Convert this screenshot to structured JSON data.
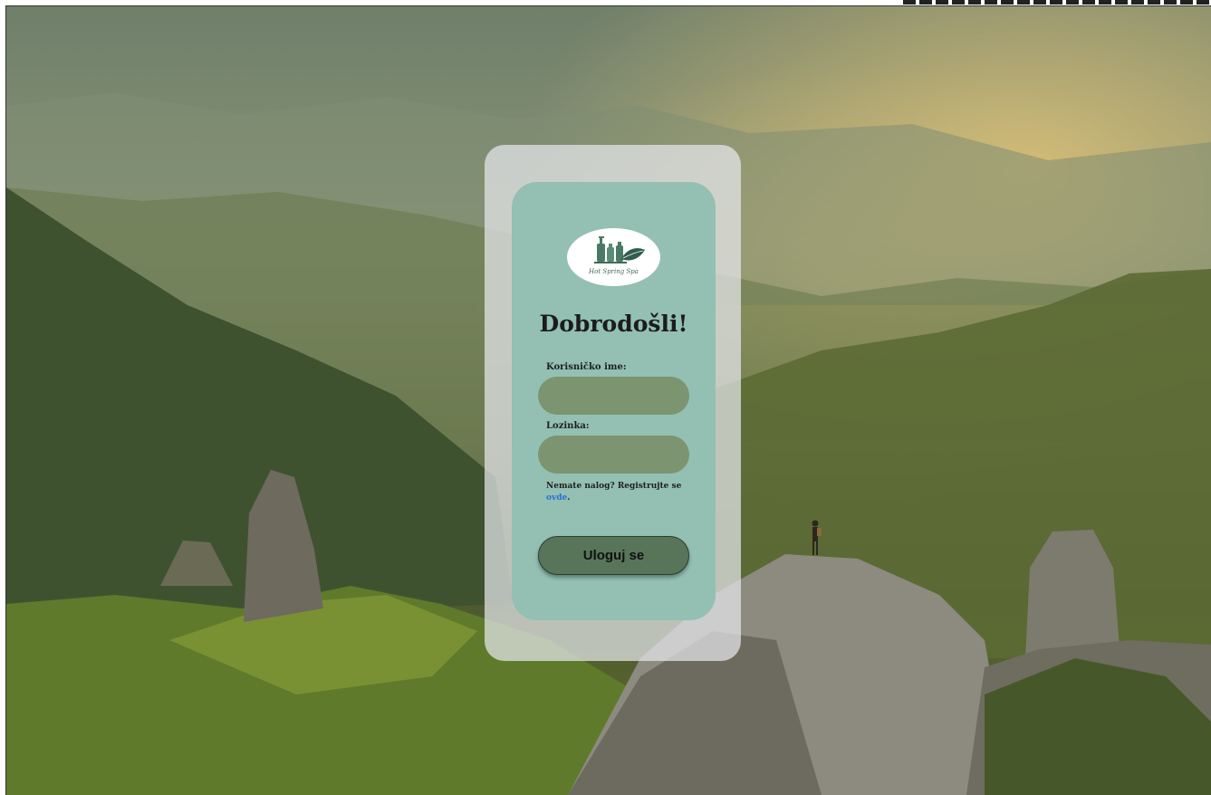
{
  "logo": {
    "text": "Hot Spring Spa",
    "icon": "spa-bottles-leaf-icon"
  },
  "login": {
    "title": "Dobrodošli!",
    "username_label": "Korisničko ime:",
    "username_value": "",
    "password_label": "Lozinka:",
    "password_value": "",
    "register_prefix": "Nemate nalog? Registrujte se ",
    "register_link": "ovde",
    "register_suffix": ".",
    "submit_label": "Uloguj se"
  },
  "colors": {
    "card_outer": "#e6e8eb",
    "card_inner": "#93c0b3",
    "field": "#7c9470",
    "button": "#58755a",
    "link": "#2a6fd6"
  }
}
